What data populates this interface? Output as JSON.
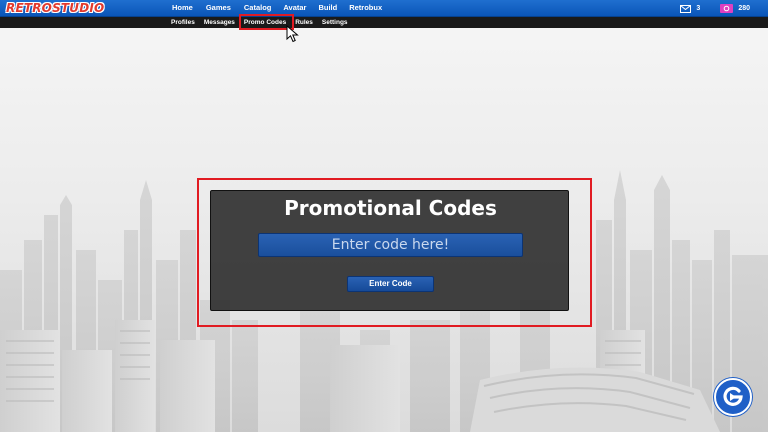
{
  "app": {
    "logo_text": "RETROSTUDIO"
  },
  "main_nav": {
    "items": [
      "Home",
      "Games",
      "Catalog",
      "Avatar",
      "Build",
      "Retrobux"
    ]
  },
  "stats": {
    "messages_count": "3",
    "currency_amount": "280"
  },
  "sub_nav": {
    "items": [
      "Profiles",
      "Messages",
      "Promo Codes",
      "Rules",
      "Settings"
    ],
    "highlighted": "Promo Codes"
  },
  "promo_panel": {
    "title": "Promotional Codes",
    "input_placeholder": "Enter code here!",
    "input_value": "",
    "button_label": "Enter Code"
  },
  "colors": {
    "topbar_blue": "#0a55b8",
    "subbar_dark": "#1a1a1a",
    "highlight_red": "#e11b22",
    "button_blue": "#1a4f9c",
    "badge_blue": "#1f5fc7"
  },
  "icons": {
    "messages": "envelope-icon",
    "currency": "retrobux-icon",
    "cursor": "mouse-pointer-icon",
    "badge": "gamer-logo-icon"
  }
}
